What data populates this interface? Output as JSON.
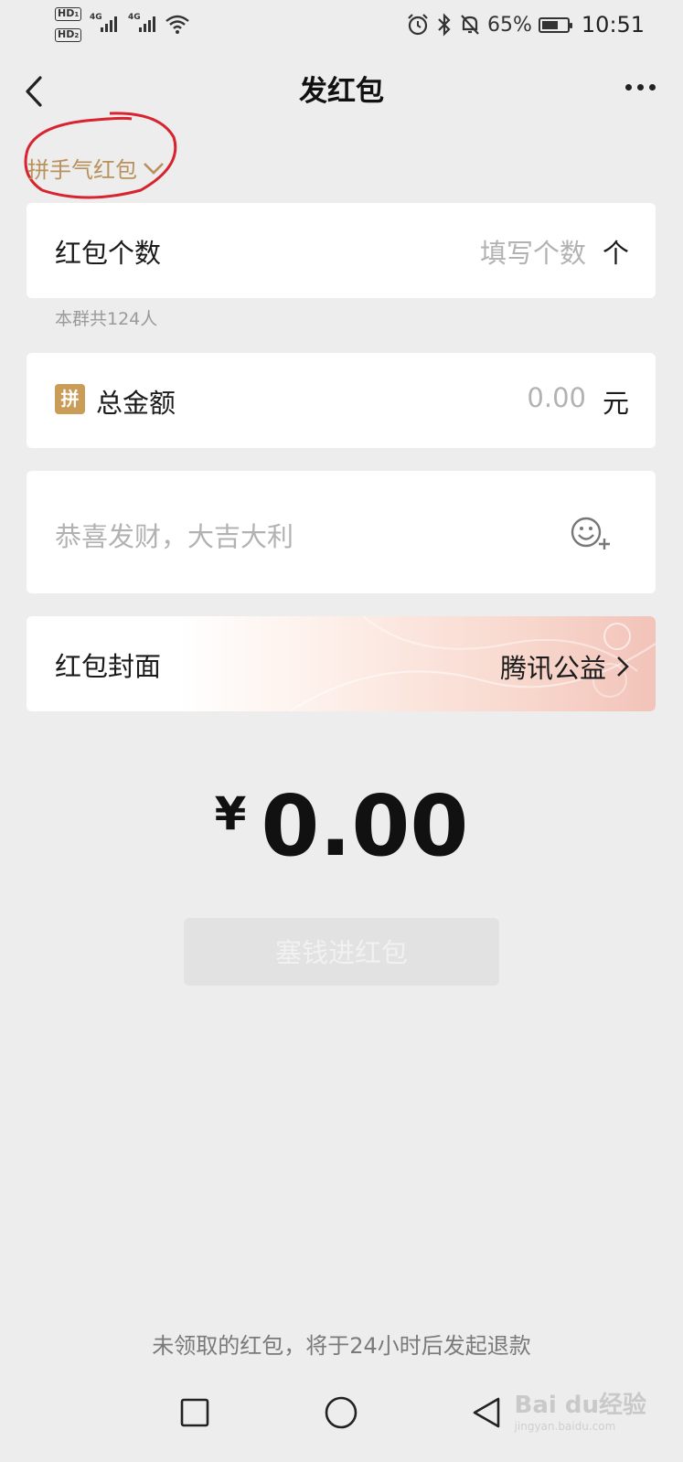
{
  "status_bar": {
    "hd1": "HD",
    "hd1_sub": "1",
    "hd2": "HD",
    "hd2_sub": "2",
    "net1": "4G",
    "net2": "4G",
    "battery_percent": "65%",
    "battery_level": 0.65,
    "time": "10:51",
    "icons": [
      "alarm-icon",
      "bluetooth-icon",
      "mute-bell-icon",
      "battery-icon",
      "wifi-icon"
    ]
  },
  "header": {
    "title": "发红包"
  },
  "packet_type": {
    "label": "拼手气红包"
  },
  "count_card": {
    "label": "红包个数",
    "placeholder": "填写个数",
    "unit": "个",
    "hint": "本群共124人"
  },
  "amount_card": {
    "badge": "拼",
    "label": "总金额",
    "placeholder": "0.00",
    "unit": "元"
  },
  "message_card": {
    "placeholder": "恭喜发财，大吉大利"
  },
  "cover_card": {
    "label": "红包封面",
    "value": "腾讯公益"
  },
  "total": {
    "currency": "¥",
    "value": "0.00"
  },
  "submit": {
    "label": "塞钱进红包"
  },
  "footer": {
    "refund_note": "未领取的红包，将于24小时后发起退款"
  },
  "watermark": {
    "brand": "Bai du经验",
    "url": "jingyan.baidu.com"
  },
  "colors": {
    "accent_gold": "#b8915b",
    "badge_gold": "#c99c57",
    "annotation_red": "#d7242f",
    "background": "#ededed"
  }
}
